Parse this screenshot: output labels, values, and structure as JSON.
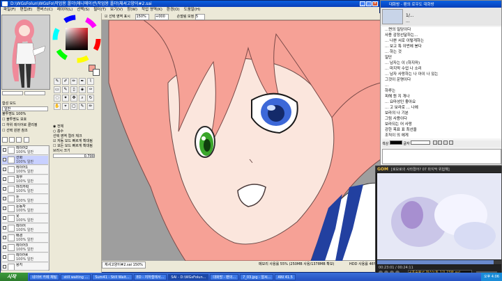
{
  "sai": {
    "title": "D:\\WGsFolun\\WGsFo\\작업용 폴더\\애니메이션\\작업용 폴더\\체셔고양이#2.sai",
    "menu": [
      "파일(F)",
      "편집(E)",
      "캔버스(C)",
      "레이어(L)",
      "선택(S)",
      "필터(T)",
      "보기(V)",
      "창(W)",
      "작업 영역(K)",
      "환경(O)",
      "도움말(H)"
    ],
    "toolbar": {
      "select_label": "선택 영역 표시",
      "zoom": "150%",
      "angle": "+000",
      "stabilizer_label": "손떨림 보정",
      "stabilizer_value": "5"
    },
    "colors": {
      "fg": "#f4a296",
      "bg": "#ffffff"
    },
    "layer_props": {
      "mode_label": "합성 모드",
      "mode_value": "일반",
      "opacity_label": "불투명도",
      "opacity_value": "100%",
      "options": [
        "불투명도 보호",
        "하위 레이어로 클리핑",
        "선택 원본 참조"
      ]
    },
    "tool_options": {
      "brush_label": "브러시",
      "size_label": "브러시 크기",
      "size_value": "x 1.0",
      "mode_options": [
        "자동 모드 빠르게 확대됨",
        "모든 모드 빠르게 확대됨"
      ],
      "radio_labels": [
        "전체",
        "흡수"
      ],
      "color_check_label": "선택 영역 컬러 체크",
      "color_value": "1",
      "tolerance_value": "0.700"
    },
    "layers": [
      {
        "name": "레이어2",
        "pct": "100% 일반"
      },
      {
        "name": "선화",
        "pct": "100% 일반"
      },
      {
        "name": "레이어1",
        "pct": "100% 일반"
      },
      {
        "name": "피부",
        "pct": "100% 일반"
      },
      {
        "name": "머리카락",
        "pct": "100% 일반"
      },
      {
        "name": "눈",
        "pct": "100% 일반"
      },
      {
        "name": "눈동자",
        "pct": "100% 일반"
      },
      {
        "name": "옷",
        "pct": "100% 일반"
      },
      {
        "name": "레이어",
        "pct": "100% 일반"
      },
      {
        "name": "배경",
        "pct": "100% 일반"
      },
      {
        "name": "레이어3",
        "pct": "100% 일반"
      },
      {
        "name": "레이어4",
        "pct": "100% 일반"
      },
      {
        "name": "용지",
        "pct": "100% 일반"
      }
    ],
    "status": {
      "tab": "체셔고양이#2.sai",
      "tab_zoom": "150%",
      "memory": "메모리 사용률 55% (250MB 사용/1378MB 확보)",
      "drive": "HDD 사용률 46%"
    }
  },
  "chat": {
    "title": "대화방 - 팬의 로우도 대화방",
    "topic": "...",
    "tab": "1/...",
    "messages": [
      "...면의 밀당이다",
      "사용 감정선달하는...",
      "... 나쁜 서로 이렇게하는",
      "... 보고 특 이번에 봉다",
      "... 하는 것",
      "일단",
      "... 남자는 이 (하지마)",
      "... 마지막 수업 나 소리",
      "... 남자 사랑하는 나 아이 나 있는",
      "그것이 운명이다",
      "...",
      "하루는",
      "피해 뭔 지 개나",
      "... 요마성인 좋아요",
      "... 고 보라로 ... 나에",
      "보라의 나 기분",
      "그림 사용이다",
      "보라되는 어 사랑",
      "강한 목표 표 최선을",
      "조직이 의 에게"
    ],
    "input_label": "색상",
    "size_label": "글자"
  },
  "gom": {
    "title": "[로모로의 사라졌어? 07 마지막 위험해]",
    "time": "00:23:01 / 00:24:11",
    "subtitle": "공포증후군 데스노트 1기 23화.avi",
    "logo": "GOM"
  },
  "taskbar": {
    "start_label": "시작",
    "tasks": [
      "네이버 카페 채팅",
      "still waiting ...",
      "Sum41 - Still Wait...",
      "ED - 지하철에서...",
      "SAI - D:\\WGsFolun...",
      "대화방 - 팬의...",
      "7_03.jpg - 알씨...",
      "ANI 41.5"
    ],
    "clock": "오후 4:06"
  }
}
